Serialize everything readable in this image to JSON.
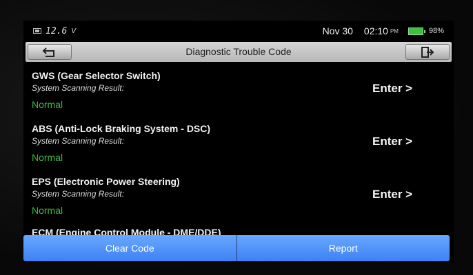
{
  "status_bar": {
    "voltage": "12.6",
    "voltage_unit": "V",
    "date": "Nov 30",
    "time": "02:10",
    "ampm": "PM",
    "battery_percent": "98%",
    "battery_color": "#3fbf3f"
  },
  "header": {
    "title": "Diagnostic Trouble Code",
    "back_icon": "back-arrow-icon",
    "exit_icon": "exit-door-icon"
  },
  "systems": [
    {
      "name": "GWS (Gear Selector Switch)",
      "result_label": "System Scanning Result:",
      "status": "Normal",
      "action": "Enter >"
    },
    {
      "name": "ABS (Anti-Lock Braking System - DSC)",
      "result_label": "System Scanning Result:",
      "status": "Normal",
      "action": "Enter >"
    },
    {
      "name": "EPS (Electronic Power Steering)",
      "result_label": "System Scanning Result:",
      "status": "Normal",
      "action": "Enter >"
    }
  ],
  "partial_row": {
    "name": "ECM (Engine Control Module - DME/DDE)"
  },
  "footer": {
    "clear_label": "Clear Code",
    "report_label": "Report",
    "accent_color": "#4a8ef8"
  },
  "colors": {
    "status_normal": "#3fb548"
  }
}
